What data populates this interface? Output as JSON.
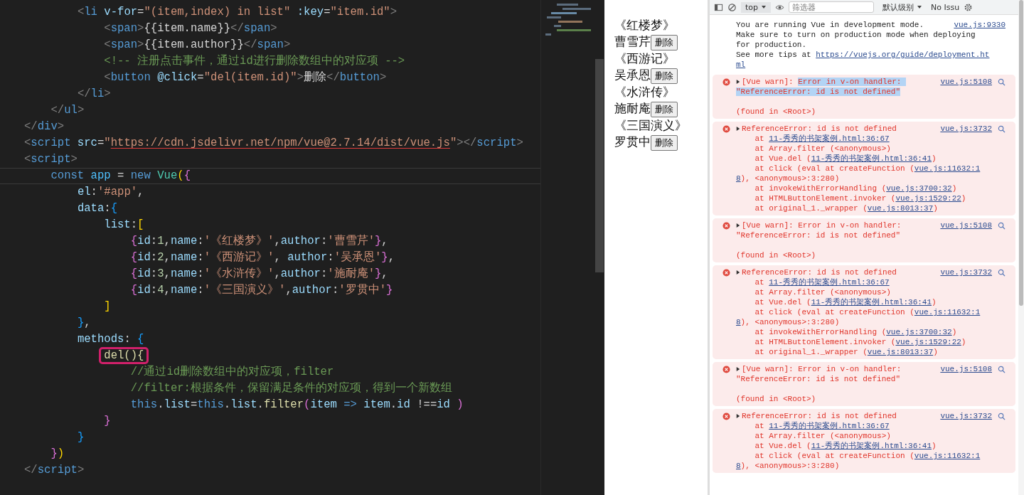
{
  "editor": {
    "lines": [
      {
        "current": false,
        "boxed": false,
        "tokens": [
          {
            "text": "        <",
            "kind": "p"
          },
          {
            "text": "li",
            "kind": "tag"
          },
          {
            "text": " v-for",
            "kind": "attr"
          },
          {
            "text": "=",
            "kind": "txt"
          },
          {
            "text": "\"(item,index) in list\"",
            "kind": "str"
          },
          {
            "text": " :key",
            "kind": "attr"
          },
          {
            "text": "=",
            "kind": "txt"
          },
          {
            "text": "\"item.id\"",
            "kind": "str"
          },
          {
            "text": ">",
            "kind": "p"
          }
        ]
      },
      {
        "current": false,
        "boxed": false,
        "tokens": [
          {
            "text": "            <",
            "kind": "p"
          },
          {
            "text": "span",
            "kind": "tag"
          },
          {
            "text": ">",
            "kind": "p"
          },
          {
            "text": "{{item.name}}",
            "kind": "txt"
          },
          {
            "text": "</",
            "kind": "p"
          },
          {
            "text": "span",
            "kind": "tag"
          },
          {
            "text": ">",
            "kind": "p"
          }
        ]
      },
      {
        "current": false,
        "boxed": false,
        "tokens": [
          {
            "text": "            <",
            "kind": "p"
          },
          {
            "text": "span",
            "kind": "tag"
          },
          {
            "text": ">",
            "kind": "p"
          },
          {
            "text": "{{item.author}}",
            "kind": "txt"
          },
          {
            "text": "</",
            "kind": "p"
          },
          {
            "text": "span",
            "kind": "tag"
          },
          {
            "text": ">",
            "kind": "p"
          }
        ]
      },
      {
        "current": false,
        "boxed": false,
        "tokens": [
          {
            "text": "            <!-- 注册点击事件，通过id进行删除数组中的对应项 -->",
            "kind": "cmt"
          }
        ]
      },
      {
        "current": false,
        "boxed": false,
        "tokens": [
          {
            "text": "            <",
            "kind": "p"
          },
          {
            "text": "button",
            "kind": "tag"
          },
          {
            "text": " @click",
            "kind": "attr"
          },
          {
            "text": "=",
            "kind": "txt"
          },
          {
            "text": "\"del(item.id)\"",
            "kind": "str"
          },
          {
            "text": ">",
            "kind": "p"
          },
          {
            "text": "删除",
            "kind": "txt"
          },
          {
            "text": "</",
            "kind": "p"
          },
          {
            "text": "button",
            "kind": "tag"
          },
          {
            "text": ">",
            "kind": "p"
          }
        ]
      },
      {
        "current": false,
        "boxed": false,
        "tokens": [
          {
            "text": "        </",
            "kind": "p"
          },
          {
            "text": "li",
            "kind": "tag"
          },
          {
            "text": ">",
            "kind": "p"
          }
        ]
      },
      {
        "current": false,
        "boxed": false,
        "tokens": [
          {
            "text": "    </",
            "kind": "p"
          },
          {
            "text": "ul",
            "kind": "tag"
          },
          {
            "text": ">",
            "kind": "p"
          }
        ]
      },
      {
        "current": false,
        "boxed": false,
        "tokens": [
          {
            "text": "</",
            "kind": "p"
          },
          {
            "text": "div",
            "kind": "tag"
          },
          {
            "text": ">",
            "kind": "p"
          }
        ]
      },
      {
        "current": false,
        "boxed": false,
        "tokens": [
          {
            "text": "<",
            "kind": "p"
          },
          {
            "text": "script",
            "kind": "tag"
          },
          {
            "text": " src",
            "kind": "attr"
          },
          {
            "text": "=",
            "kind": "txt"
          },
          {
            "text": "\"",
            "kind": "str"
          },
          {
            "text": "https://cdn.jsdelivr.net/npm/vue@2.7.14/dist/vue.js",
            "kind": "url"
          },
          {
            "text": "\"",
            "kind": "str"
          },
          {
            "text": "></",
            "kind": "p"
          },
          {
            "text": "script",
            "kind": "tag"
          },
          {
            "text": ">",
            "kind": "p"
          }
        ]
      },
      {
        "current": false,
        "boxed": false,
        "tokens": [
          {
            "text": "<",
            "kind": "p"
          },
          {
            "text": "script",
            "kind": "tag"
          },
          {
            "text": ">",
            "kind": "p"
          }
        ]
      },
      {
        "current": true,
        "boxed": false,
        "tokens": [
          {
            "text": "    const ",
            "kind": "kw"
          },
          {
            "text": "app",
            "kind": "const"
          },
          {
            "text": " = ",
            "kind": "txt"
          },
          {
            "text": "new ",
            "kind": "kw"
          },
          {
            "text": "Vue",
            "kind": "cls"
          },
          {
            "text": "(",
            "kind": "b1"
          },
          {
            "text": "{",
            "kind": "b2"
          }
        ]
      },
      {
        "current": false,
        "boxed": false,
        "tokens": [
          {
            "text": "        el",
            "kind": "var"
          },
          {
            "text": ":",
            "kind": "txt"
          },
          {
            "text": "'#app'",
            "kind": "str"
          },
          {
            "text": ",",
            "kind": "txt"
          }
        ]
      },
      {
        "current": false,
        "boxed": false,
        "tokens": [
          {
            "text": "        data",
            "kind": "var"
          },
          {
            "text": ":",
            "kind": "txt"
          },
          {
            "text": "{",
            "kind": "b3"
          }
        ]
      },
      {
        "current": false,
        "boxed": false,
        "tokens": [
          {
            "text": "            list",
            "kind": "var"
          },
          {
            "text": ":",
            "kind": "txt"
          },
          {
            "text": "[",
            "kind": "b1"
          }
        ]
      },
      {
        "current": false,
        "boxed": false,
        "tokens": [
          {
            "text": "                {",
            "kind": "b2"
          },
          {
            "text": "id",
            "kind": "var"
          },
          {
            "text": ":",
            "kind": "txt"
          },
          {
            "text": "1",
            "kind": "num"
          },
          {
            "text": ",",
            "kind": "txt"
          },
          {
            "text": "name",
            "kind": "var"
          },
          {
            "text": ":",
            "kind": "txt"
          },
          {
            "text": "'《红楼梦》'",
            "kind": "str"
          },
          {
            "text": ",",
            "kind": "txt"
          },
          {
            "text": "author",
            "kind": "var"
          },
          {
            "text": ":",
            "kind": "txt"
          },
          {
            "text": "'曹雪芹'",
            "kind": "str"
          },
          {
            "text": "}",
            "kind": "b2"
          },
          {
            "text": ",",
            "kind": "txt"
          }
        ]
      },
      {
        "current": false,
        "boxed": false,
        "tokens": [
          {
            "text": "                {",
            "kind": "b2"
          },
          {
            "text": "id",
            "kind": "var"
          },
          {
            "text": ":",
            "kind": "txt"
          },
          {
            "text": "2",
            "kind": "num"
          },
          {
            "text": ",",
            "kind": "txt"
          },
          {
            "text": "name",
            "kind": "var"
          },
          {
            "text": ":",
            "kind": "txt"
          },
          {
            "text": "'《西游记》'",
            "kind": "str"
          },
          {
            "text": ", ",
            "kind": "txt"
          },
          {
            "text": "author",
            "kind": "var"
          },
          {
            "text": ":",
            "kind": "txt"
          },
          {
            "text": "'吴承恩'",
            "kind": "str"
          },
          {
            "text": "}",
            "kind": "b2"
          },
          {
            "text": ",",
            "kind": "txt"
          }
        ]
      },
      {
        "current": false,
        "boxed": false,
        "tokens": [
          {
            "text": "                {",
            "kind": "b2"
          },
          {
            "text": "id",
            "kind": "var"
          },
          {
            "text": ":",
            "kind": "txt"
          },
          {
            "text": "3",
            "kind": "num"
          },
          {
            "text": ",",
            "kind": "txt"
          },
          {
            "text": "name",
            "kind": "var"
          },
          {
            "text": ":",
            "kind": "txt"
          },
          {
            "text": "'《水浒传》'",
            "kind": "str"
          },
          {
            "text": ",",
            "kind": "txt"
          },
          {
            "text": "author",
            "kind": "var"
          },
          {
            "text": ":",
            "kind": "txt"
          },
          {
            "text": "'施耐庵'",
            "kind": "str"
          },
          {
            "text": "}",
            "kind": "b2"
          },
          {
            "text": ",",
            "kind": "txt"
          }
        ]
      },
      {
        "current": false,
        "boxed": false,
        "tokens": [
          {
            "text": "                {",
            "kind": "b2"
          },
          {
            "text": "id",
            "kind": "var"
          },
          {
            "text": ":",
            "kind": "txt"
          },
          {
            "text": "4",
            "kind": "num"
          },
          {
            "text": ",",
            "kind": "txt"
          },
          {
            "text": "name",
            "kind": "var"
          },
          {
            "text": ":",
            "kind": "txt"
          },
          {
            "text": "'《三国演义》'",
            "kind": "str"
          },
          {
            "text": ",",
            "kind": "txt"
          },
          {
            "text": "author",
            "kind": "var"
          },
          {
            "text": ":",
            "kind": "txt"
          },
          {
            "text": "'罗贯中'",
            "kind": "str"
          },
          {
            "text": "}",
            "kind": "b2"
          }
        ]
      },
      {
        "current": false,
        "boxed": false,
        "tokens": [
          {
            "text": "            ]",
            "kind": "b1"
          }
        ]
      },
      {
        "current": false,
        "boxed": false,
        "tokens": [
          {
            "text": "        }",
            "kind": "b3"
          },
          {
            "text": ",",
            "kind": "txt"
          }
        ]
      },
      {
        "current": false,
        "boxed": false,
        "tokens": [
          {
            "text": "        methods",
            "kind": "var"
          },
          {
            "text": ": ",
            "kind": "txt"
          },
          {
            "text": "{",
            "kind": "b3"
          }
        ]
      },
      {
        "current": false,
        "boxed": true,
        "tokens": [
          {
            "text": "            del(){",
            "kind": "fn"
          }
        ]
      },
      {
        "current": false,
        "boxed": false,
        "tokens": [
          {
            "text": "                //通过id删除数组中的对应项，filter",
            "kind": "cmt"
          }
        ]
      },
      {
        "current": false,
        "boxed": false,
        "tokens": [
          {
            "text": "                //filter:根据条件，保留满足条件的对应项，得到一个新数组",
            "kind": "cmt"
          }
        ]
      },
      {
        "current": false,
        "boxed": false,
        "tokens": [
          {
            "text": "                this",
            "kind": "kw"
          },
          {
            "text": ".",
            "kind": "txt"
          },
          {
            "text": "list",
            "kind": "var"
          },
          {
            "text": "=",
            "kind": "txt"
          },
          {
            "text": "this",
            "kind": "kw"
          },
          {
            "text": ".",
            "kind": "txt"
          },
          {
            "text": "list",
            "kind": "var"
          },
          {
            "text": ".",
            "kind": "txt"
          },
          {
            "text": "filter",
            "kind": "fn"
          },
          {
            "text": "(",
            "kind": "b2"
          },
          {
            "text": "item ",
            "kind": "var"
          },
          {
            "text": "=> ",
            "kind": "kw"
          },
          {
            "text": "item",
            "kind": "var"
          },
          {
            "text": ".",
            "kind": "txt"
          },
          {
            "text": "id",
            "kind": "var"
          },
          {
            "text": " !==",
            "kind": "txt"
          },
          {
            "text": "id ",
            "kind": "var"
          },
          {
            "text": ")",
            "kind": "b2"
          }
        ]
      },
      {
        "current": false,
        "boxed": false,
        "tokens": [
          {
            "text": "            }",
            "kind": "b2"
          }
        ]
      },
      {
        "current": false,
        "boxed": false,
        "tokens": [
          {
            "text": "        }",
            "kind": "b3"
          }
        ]
      },
      {
        "current": false,
        "boxed": false,
        "tokens": [
          {
            "text": "    }",
            "kind": "b2"
          },
          {
            "text": ")",
            "kind": "b1"
          }
        ]
      },
      {
        "current": false,
        "boxed": false,
        "tokens": [
          {
            "text": "</",
            "kind": "p"
          },
          {
            "text": "script",
            "kind": "tag"
          },
          {
            "text": ">",
            "kind": "p"
          }
        ]
      }
    ]
  },
  "preview": {
    "books": [
      {
        "name": "《红楼梦》",
        "author": "曹雪芹",
        "button": "删除"
      },
      {
        "name": "《西游记》",
        "author": "吴承恩",
        "button": "删除"
      },
      {
        "name": "《水浒传》",
        "author": "施耐庵",
        "button": "删除"
      },
      {
        "name": "《三国演义》",
        "author": "罗贯中",
        "button": "删除"
      }
    ]
  },
  "console": {
    "toolbar": {
      "context": "top",
      "filter_placeholder": "筛选器",
      "level": "默认级别",
      "issues": "No Issu"
    },
    "messages": [
      {
        "kind": "info",
        "source": "vue.js:9330",
        "lines": [
          [
            {
              "text": "You are running Vue in development mode.",
              "kind": "plain"
            }
          ],
          [
            {
              "text": "Make sure to turn on production mode when deploying",
              "kind": "plain"
            }
          ],
          [
            {
              "text": "for production.",
              "kind": "plain"
            }
          ],
          [
            {
              "text": "See more tips at ",
              "kind": "plain"
            },
            {
              "text": "https://vuejs.org/guide/deployment.ht",
              "kind": "link"
            }
          ],
          [
            {
              "text": "ml",
              "kind": "link"
            }
          ]
        ]
      },
      {
        "kind": "warn",
        "source": "vue.js:5108",
        "lines": [
          [
            {
              "text": "[Vue warn]: ",
              "kind": "plain"
            },
            {
              "text": "Error in v-on handler: ",
              "kind": "selected"
            }
          ],
          [
            {
              "text": "\"ReferenceError: id is not defined\"",
              "kind": "selected"
            }
          ]
        ],
        "footer": "(found in <Root>)"
      },
      {
        "kind": "error",
        "source": "vue.js:3732",
        "lines": [
          [
            {
              "text": "ReferenceError: id is not defined",
              "kind": "plain"
            }
          ],
          [
            {
              "text": "    at ",
              "kind": "plain"
            },
            {
              "text": "11-秀秀的书架案例.html:36:67",
              "kind": "link"
            }
          ],
          [
            {
              "text": "    at Array.filter (<anonymous>)",
              "kind": "plain"
            }
          ],
          [
            {
              "text": "    at Vue.del (",
              "kind": "plain"
            },
            {
              "text": "11-秀秀的书架案例.html:36:41",
              "kind": "link"
            },
            {
              "text": ")",
              "kind": "plain"
            }
          ],
          [
            {
              "text": "    at click (eval at createFunction (",
              "kind": "plain"
            },
            {
              "text": "vue.js:11632:1",
              "kind": "link"
            }
          ],
          [
            {
              "text": "8",
              "kind": "link"
            },
            {
              "text": "), <anonymous>:3:280)",
              "kind": "plain"
            }
          ],
          [
            {
              "text": "    at invokeWithErrorHandling (",
              "kind": "plain"
            },
            {
              "text": "vue.js:3700:32",
              "kind": "link"
            },
            {
              "text": ")",
              "kind": "plain"
            }
          ],
          [
            {
              "text": "    at HTMLButtonElement.invoker (",
              "kind": "plain"
            },
            {
              "text": "vue.js:1529:22",
              "kind": "link"
            },
            {
              "text": ")",
              "kind": "plain"
            }
          ],
          [
            {
              "text": "    at original_1._wrapper (",
              "kind": "plain"
            },
            {
              "text": "vue.js:8013:37",
              "kind": "link"
            },
            {
              "text": ")",
              "kind": "plain"
            }
          ]
        ]
      },
      {
        "kind": "warn",
        "source": "vue.js:5108",
        "lines": [
          [
            {
              "text": "[Vue warn]: Error in v-on handler:",
              "kind": "plain"
            }
          ],
          [
            {
              "text": "\"ReferenceError: id is not defined\"",
              "kind": "plain"
            }
          ]
        ],
        "footer": "(found in <Root>)"
      },
      {
        "kind": "error",
        "source": "vue.js:3732",
        "lines": [
          [
            {
              "text": "ReferenceError: id is not defined",
              "kind": "plain"
            }
          ],
          [
            {
              "text": "    at ",
              "kind": "plain"
            },
            {
              "text": "11-秀秀的书架案例.html:36:67",
              "kind": "link"
            }
          ],
          [
            {
              "text": "    at Array.filter (<anonymous>)",
              "kind": "plain"
            }
          ],
          [
            {
              "text": "    at Vue.del (",
              "kind": "plain"
            },
            {
              "text": "11-秀秀的书架案例.html:36:41",
              "kind": "link"
            },
            {
              "text": ")",
              "kind": "plain"
            }
          ],
          [
            {
              "text": "    at click (eval at createFunction (",
              "kind": "plain"
            },
            {
              "text": "vue.js:11632:1",
              "kind": "link"
            }
          ],
          [
            {
              "text": "8",
              "kind": "link"
            },
            {
              "text": "), <anonymous>:3:280)",
              "kind": "plain"
            }
          ],
          [
            {
              "text": "    at invokeWithErrorHandling (",
              "kind": "plain"
            },
            {
              "text": "vue.js:3700:32",
              "kind": "link"
            },
            {
              "text": ")",
              "kind": "plain"
            }
          ],
          [
            {
              "text": "    at HTMLButtonElement.invoker (",
              "kind": "plain"
            },
            {
              "text": "vue.js:1529:22",
              "kind": "link"
            },
            {
              "text": ")",
              "kind": "plain"
            }
          ],
          [
            {
              "text": "    at original_1._wrapper (",
              "kind": "plain"
            },
            {
              "text": "vue.js:8013:37",
              "kind": "link"
            },
            {
              "text": ")",
              "kind": "plain"
            }
          ]
        ]
      },
      {
        "kind": "warn",
        "source": "vue.js:5108",
        "lines": [
          [
            {
              "text": "[Vue warn]: Error in v-on handler:",
              "kind": "plain"
            }
          ],
          [
            {
              "text": "\"ReferenceError: id is not defined\"",
              "kind": "plain"
            }
          ]
        ],
        "footer": "(found in <Root>)"
      },
      {
        "kind": "error",
        "source": "vue.js:3732",
        "lines": [
          [
            {
              "text": "ReferenceError: id is not defined",
              "kind": "plain"
            }
          ],
          [
            {
              "text": "    at ",
              "kind": "plain"
            },
            {
              "text": "11-秀秀的书架案例.html:36:67",
              "kind": "link"
            }
          ],
          [
            {
              "text": "    at Array.filter (<anonymous>)",
              "kind": "plain"
            }
          ],
          [
            {
              "text": "    at Vue.del (",
              "kind": "plain"
            },
            {
              "text": "11-秀秀的书架案例.html:36:41",
              "kind": "link"
            },
            {
              "text": ")",
              "kind": "plain"
            }
          ],
          [
            {
              "text": "    at click (eval at createFunction (",
              "kind": "plain"
            },
            {
              "text": "vue.js:11632:1",
              "kind": "link"
            }
          ],
          [
            {
              "text": "8",
              "kind": "link"
            },
            {
              "text": "), <anonymous>:3:280)",
              "kind": "plain"
            }
          ]
        ]
      }
    ]
  }
}
